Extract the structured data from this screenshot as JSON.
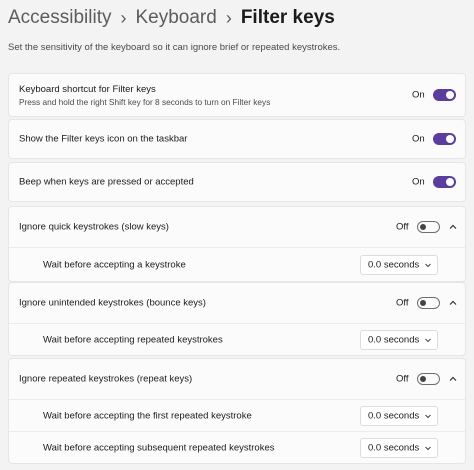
{
  "breadcrumb": {
    "item1": "Accessibility",
    "item2": "Keyboard",
    "current": "Filter keys",
    "separator": "›"
  },
  "description": "Set the sensitivity of the keyboard so it can ignore brief or repeated keystrokes.",
  "settings": {
    "shortcut": {
      "title": "Keyboard shortcut for Filter keys",
      "subtitle": "Press and hold the right Shift key for 8 seconds to turn on Filter keys",
      "state": "On"
    },
    "taskbar_icon": {
      "title": "Show the Filter keys icon on the taskbar",
      "state": "On"
    },
    "beep": {
      "title": "Beep when keys are pressed or accepted",
      "state": "On"
    },
    "slow_keys": {
      "title": "Ignore quick keystrokes (slow keys)",
      "state": "Off",
      "sub": {
        "label": "Wait before accepting a keystroke",
        "value": "0.0 seconds"
      }
    },
    "bounce_keys": {
      "title": "Ignore unintended keystrokes (bounce keys)",
      "state": "Off",
      "sub": {
        "label": "Wait before accepting repeated keystrokes",
        "value": "0.0 seconds"
      }
    },
    "repeat_keys": {
      "title": "Ignore repeated keystrokes (repeat keys)",
      "state": "Off",
      "sub1": {
        "label": "Wait before accepting the first repeated keystroke",
        "value": "0.0 seconds"
      },
      "sub2": {
        "label": "Wait before accepting subsequent repeated keystrokes",
        "value": "0.0 seconds"
      }
    }
  },
  "colors": {
    "toggle_on": "#5b3d9e",
    "background": "#f3f3f3",
    "card": "#fbfbfb"
  }
}
